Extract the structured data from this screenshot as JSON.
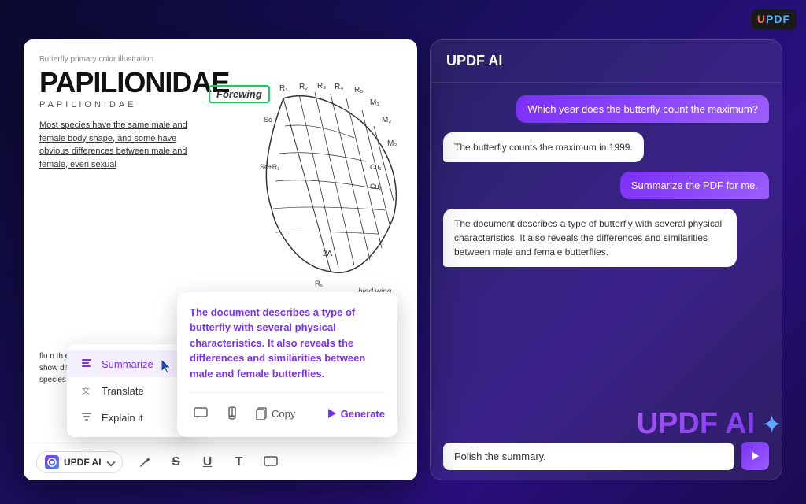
{
  "logo": {
    "u": "U",
    "pdf": "PDF"
  },
  "pdf_panel": {
    "subtitle": "Butterfly primary color illustration",
    "title": "PAPILIONIDAE",
    "title_sub": "PAPILIONIDAE",
    "body_text": "Most species have the same male and female body shape, and some have obvious differences between male and female, even sexual",
    "body_text2": "flu n th edge folds of hindwings, and them show differences due to seasons, and some species h multiple types of females.",
    "forewing_label": "Forewing",
    "hind_wing_label": "hind wing",
    "toolbar": {
      "ai_btn": "UPDF AI",
      "ai_btn_arrow": "▾"
    }
  },
  "dropdown": {
    "items": [
      {
        "id": "summarize",
        "label": "Summarize",
        "active": true
      },
      {
        "id": "translate",
        "label": "Translate",
        "active": false
      },
      {
        "id": "explain",
        "label": "Explain it",
        "active": false
      }
    ]
  },
  "summary_popup": {
    "text": "The document describes a type of butterfly with several physical characteristics. It also reveals the differences and similarities between male and female butterflies.",
    "copy_label": "Copy",
    "generate_label": "Generate"
  },
  "ai_panel": {
    "title": "UPDF AI",
    "messages": [
      {
        "type": "user",
        "text": "Which year does the butterfly count the maximum?"
      },
      {
        "type": "ai",
        "text": "The butterfly counts the maximum in 1999."
      },
      {
        "type": "user",
        "text": "Summarize the PDF for me."
      },
      {
        "type": "ai",
        "text": "The document describes a type of butterfly with several physical characteristics. It also reveals the differences and similarities between male and female butterflies."
      }
    ],
    "input_value": "Polish the summary.",
    "input_placeholder": "Polish the summary."
  },
  "brand": {
    "text": "UPDF AI"
  }
}
